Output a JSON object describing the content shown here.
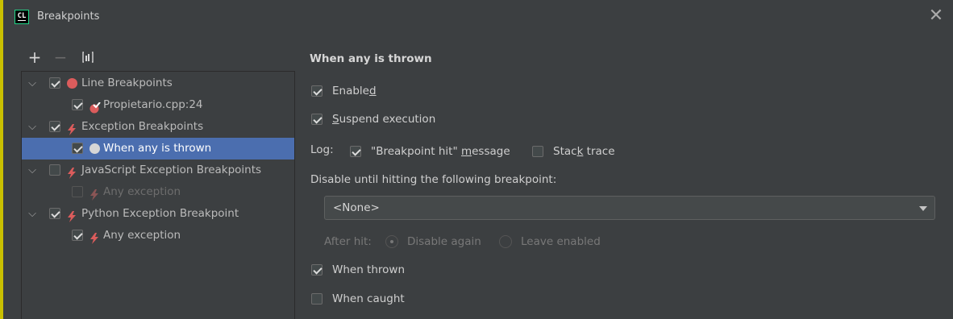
{
  "window": {
    "app_icon_text": "CL",
    "title": "Breakpoints",
    "close_glyph": "✕"
  },
  "toolbar": {
    "add_glyph": "+",
    "remove_glyph": "−"
  },
  "tree": [
    {
      "label": "Line Breakpoints",
      "checked": true,
      "icon": "red-dot",
      "expanded": true
    },
    {
      "label": "Propietario.cpp:24",
      "checked": true,
      "icon": "red-check-breakpoint"
    },
    {
      "label": "Exception Breakpoints",
      "checked": true,
      "icon": "lightning",
      "expanded": true
    },
    {
      "label": "When any is thrown",
      "checked": true,
      "icon": "white-dot",
      "selected": true
    },
    {
      "label": "JavaScript Exception Breakpoints",
      "checked": false,
      "icon": "lightning",
      "expanded": true
    },
    {
      "label": "Any exception",
      "checked": false,
      "icon": "lightning-dim",
      "disabled": true
    },
    {
      "label": "Python Exception Breakpoint",
      "checked": true,
      "icon": "lightning",
      "expanded": true
    },
    {
      "label": "Any exception",
      "checked": true,
      "icon": "lightning"
    }
  ],
  "details": {
    "heading": "When any is thrown",
    "enabled_label_pre": "Enable",
    "enabled_label_mn": "d",
    "suspend_label_mn": "S",
    "suspend_label_post": "uspend execution",
    "log_label": "Log:",
    "log_msg_pre": "\"Breakpoint hit\" ",
    "log_msg_mn": "m",
    "log_msg_post": "essage",
    "stack_pre": "Stac",
    "stack_mn": "k",
    "stack_post": " trace",
    "disable_until_label": "Disable until hitting the following breakpoint:",
    "dropdown_value": "<None>",
    "after_hit_label": "After hit:",
    "disable_again_label": "Disable again",
    "leave_enabled_label": "Leave enabled",
    "when_thrown_label": "When thrown",
    "when_caught_label": "When caught"
  },
  "colors": {
    "accent_border": "#c9c000",
    "selection": "#4b6eaf",
    "breakpoint_red": "#db5c5c"
  }
}
